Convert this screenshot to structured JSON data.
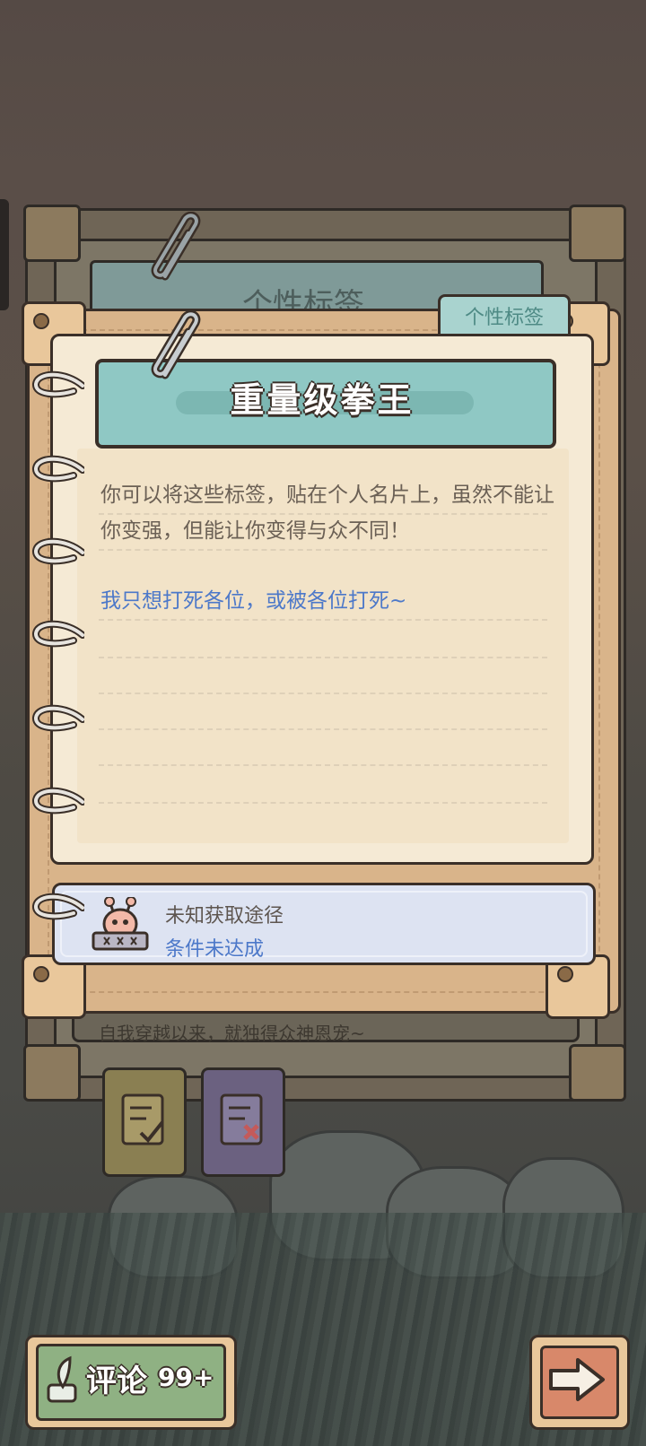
{
  "back_card": {
    "header": "个性标签",
    "text": "自我穿越以来，就独得众神恩宠~"
  },
  "tab_chip": "个性标签",
  "card": {
    "title": "重量级拳王",
    "description": "你可以将这些标签，贴在个人名片上，虽然不能让你变强，但能让你变得与众不同！",
    "quote": "我只想打死各位，或被各位打死~"
  },
  "acquisition": {
    "source": "未知获取途径",
    "status": "条件未达成"
  },
  "footer": {
    "comment_label": "评论",
    "comment_count": "99+"
  },
  "colors": {
    "paper": "#f5ead5",
    "banner": "#8fc8c4",
    "link_blue": "#4c78c9",
    "comment_green": "#8fb183",
    "next_orange": "#d8886a"
  }
}
